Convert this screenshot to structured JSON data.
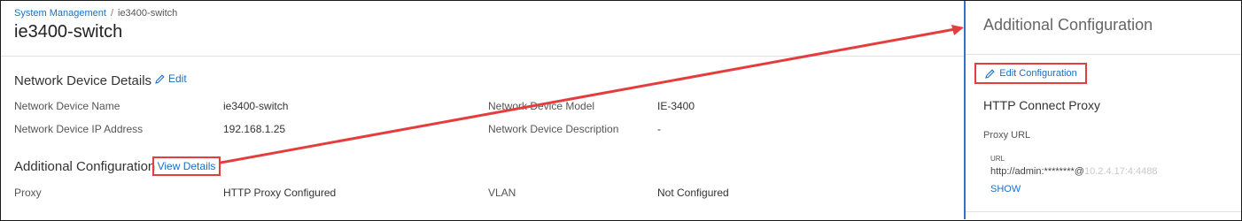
{
  "breadcrumb": {
    "parent": "System Management",
    "separator": "/",
    "current": "ie3400-switch"
  },
  "page": {
    "title": "ie3400-switch"
  },
  "device_details": {
    "title": "Network Device Details",
    "edit_label": "Edit",
    "fields": [
      {
        "label": "Network Device Name",
        "value": "ie3400-switch"
      },
      {
        "label": "Network Device Model",
        "value": "IE-3400"
      },
      {
        "label": "Network Device IP Address",
        "value": "192.168.1.25"
      },
      {
        "label": "Network Device Description",
        "value": "-"
      }
    ]
  },
  "additional_config": {
    "title": "Additional Configuration",
    "view_details_label": "View Details",
    "fields": [
      {
        "label": "Proxy",
        "value": "HTTP Proxy Configured"
      },
      {
        "label": "VLAN",
        "value": "Not Configured"
      }
    ]
  },
  "panel": {
    "title": "Additional Configuration",
    "edit_config_label": "Edit Configuration",
    "proxy_section_title": "HTTP Connect Proxy",
    "proxy_url_label": "Proxy URL",
    "url_small_label": "URL",
    "url_value_visible": "http://admin:********@",
    "url_value_faded": "10.2.4.17:4:4488",
    "show_label": "SHOW"
  },
  "colors": {
    "accent": "#1a6fc4",
    "highlight": "#e43d3d",
    "panel_border": "#2f73c7"
  },
  "icons": {
    "edit": "pencil-icon"
  }
}
